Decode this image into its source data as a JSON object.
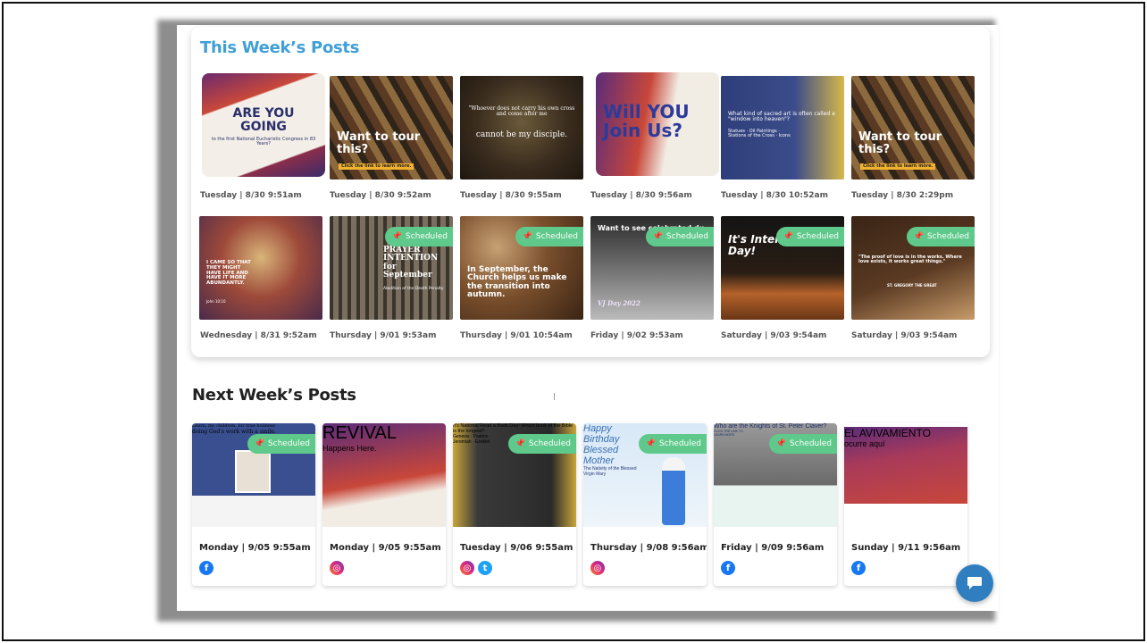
{
  "this_week": {
    "title": "This Week’s Posts",
    "posts": [
      {
        "caption": "ARE YOU GOING",
        "sub": "to the first National Eucharistic Congress in 83 Years?",
        "time": "Tuesday | 8/30 9:51am",
        "scheduled": false
      },
      {
        "caption": "Want to tour this?",
        "sub": "Click the link to learn more.",
        "time": "Tuesday | 8/30 9:52am",
        "scheduled": false
      },
      {
        "caption": "cannot be my disciple.",
        "sub": "\"Whoever does not carry his own cross and come after me",
        "time": "Tuesday | 8/30 9:55am",
        "scheduled": false
      },
      {
        "caption": "Will YOU Join Us?",
        "sub": "",
        "time": "Tuesday | 8/30 9:56am",
        "scheduled": false
      },
      {
        "caption": "What kind of sacred art is often called a \"window into heaven\"?",
        "sub": "Statues · Oil Paintings · Stations of the Cross · Icons",
        "time": "Tuesday | 8/30 10:52am",
        "scheduled": false
      },
      {
        "caption": "Want to tour this?",
        "sub": "Click the link to learn more.",
        "time": "Tuesday | 8/30 2:29pm",
        "scheduled": false
      },
      {
        "caption": "I CAME SO THAT THEY MIGHT HAVE LIFE AND HAVE IT MORE ABUNDANTLY.",
        "sub": "John 10:10",
        "time": "Wednesday | 8/31 9:52am",
        "scheduled": false
      },
      {
        "caption": "PRAYER INTENTION for September",
        "sub": "Abolition of the Death Penalty",
        "time": "Thursday | 9/01 9:53am",
        "scheduled": true
      },
      {
        "caption": "In September, the Church helps us make the transition into autumn.",
        "sub": "",
        "time": "Thursday | 9/01 10:54am",
        "scheduled": true
      },
      {
        "caption": "Want to see celebrated du",
        "sub": "VJ Day 2022",
        "time": "Friday | 9/02 9:53am",
        "scheduled": true
      },
      {
        "caption": "It's Inter Bacon Day!",
        "sub": "",
        "time": "Saturday | 9/03 9:54am",
        "scheduled": true
      },
      {
        "caption": "\"The proof of love is in the works. Where love exists, it works great things.\"",
        "sub": "ST. GREGORY THE GREAT",
        "time": "Saturday | 9/03 9:54am",
        "scheduled": true
      }
    ]
  },
  "next_week": {
    "title": "Next Week’s Posts",
    "posts": [
      {
        "caption": "doing God's work with a smile.",
        "sub": "Learn, my children, for true holiness",
        "time": "Monday | 9/05 9:55am",
        "scheduled": true,
        "social": [
          "facebook"
        ]
      },
      {
        "caption": "REVIVAL",
        "sub": "Happens Here.",
        "time": "Monday | 9/05 9:55am",
        "scheduled": false,
        "social": [
          "instagram"
        ]
      },
      {
        "caption": "It's National Read a Book Day! Which book of the Bible is the longest?",
        "sub": "Genesis · Psalms · Jeremiah · Ezekiel",
        "time": "Tuesday | 9/06 9:55am",
        "scheduled": true,
        "social": [
          "instagram",
          "twitter"
        ]
      },
      {
        "caption": "Happy Birthday Blessed Mother",
        "sub": "The Nativity of the Blessed Virgin Mary",
        "time": "Thursday | 9/08 9:56am",
        "scheduled": true,
        "social": [
          "instagram"
        ]
      },
      {
        "caption": "Who are the Knights of St. Peter Claver?",
        "sub": "CLICK THE LINK TO LEARN MORE",
        "time": "Friday | 9/09 9:56am",
        "scheduled": true,
        "social": [
          "facebook"
        ]
      },
      {
        "caption": "EL AVIVAMIENTO",
        "sub": "ocurre aquí",
        "time": "Sunday | 9/11 9:56am",
        "scheduled": false,
        "social": [
          "facebook"
        ]
      }
    ]
  },
  "badge_label": "Scheduled",
  "colors": {
    "accent": "#3f9fd6",
    "scheduled": "#5ec98a",
    "chat": "#2f7fc0"
  }
}
